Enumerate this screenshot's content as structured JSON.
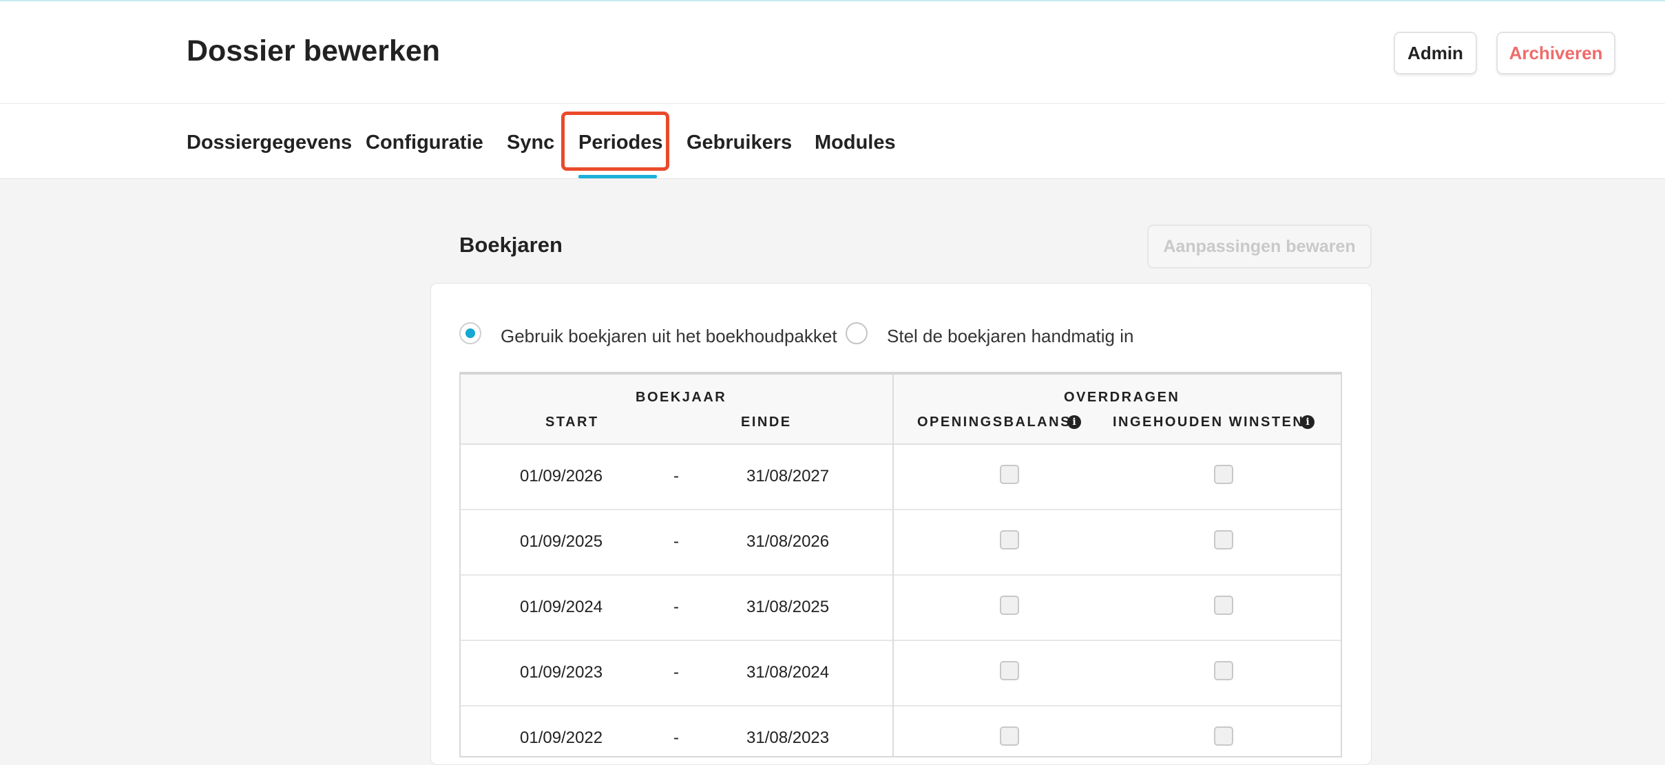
{
  "header": {
    "title": "Dossier bewerken",
    "admin_label": "Admin",
    "archive_label": "Archiveren"
  },
  "tabs": [
    {
      "label": "Dossiergegevens"
    },
    {
      "label": "Configuratie"
    },
    {
      "label": "Sync"
    },
    {
      "label": "Periodes",
      "active": true
    },
    {
      "label": "Gebruikers"
    },
    {
      "label": "Modules"
    }
  ],
  "section": {
    "title": "Boekjaren",
    "save_label": "Aanpassingen bewaren"
  },
  "options": {
    "use_package_label": "Gebruik boekjaren uit het boekhoudpakket",
    "manual_label": "Stel de boekjaren handmatig in",
    "selected": "use_package"
  },
  "table": {
    "group_boekjaar": "BOEKJAAR",
    "group_overdragen": "OVERDRAGEN",
    "col_start": "START",
    "col_einde": "EINDE",
    "col_openingsbalans": "OPENINGSBALANS",
    "col_ingehouden": "INGEHOUDEN WINSTEN",
    "separator": "-",
    "rows": [
      {
        "start": "01/09/2026",
        "end": "31/08/2027",
        "openingsbalans": false,
        "ingehouden": false
      },
      {
        "start": "01/09/2025",
        "end": "31/08/2026",
        "openingsbalans": false,
        "ingehouden": false
      },
      {
        "start": "01/09/2024",
        "end": "31/08/2025",
        "openingsbalans": false,
        "ingehouden": false
      },
      {
        "start": "01/09/2023",
        "end": "31/08/2024",
        "openingsbalans": false,
        "ingehouden": false
      },
      {
        "start": "01/09/2022",
        "end": "31/08/2023",
        "openingsbalans": false,
        "ingehouden": false
      }
    ]
  },
  "colors": {
    "accent": "#1bb1d9",
    "danger": "#ef6b6b",
    "highlight": "#ea4a2b"
  },
  "icons": {
    "info": "info-icon"
  }
}
